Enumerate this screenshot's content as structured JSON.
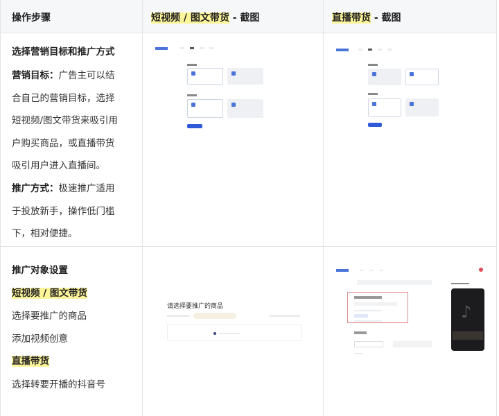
{
  "header": {
    "col1": "操作步骤",
    "col2_highlight": "短视频 / 图文带货",
    "col2_suffix": " - 截图",
    "col3_highlight": "直播带货",
    "col3_suffix": " - 截图"
  },
  "row1": {
    "lines": [
      "选择营销目标和推广方式",
      "营销目标：",
      "广告主可以结",
      "合自己的营销目标，选择",
      "短视频/图文带货来吸引用",
      "户购买商品，或直播带货",
      "吸引用户进入直播间。",
      "推广方式：",
      "极速推广适用",
      "于投放新手，操作低门槛",
      "下，相对便捷。"
    ]
  },
  "row2": {
    "lines": [
      "推广对象设置",
      "短视频 / 图文带货",
      "选择要推广的商品",
      "添加视频创意",
      "直播带货",
      "选择转要开播的抖音号"
    ],
    "screenshot_product_title": "请选择要推广的商品"
  },
  "colors": {
    "highlight": "#fdf59a",
    "accent": "#2f5bd8"
  }
}
